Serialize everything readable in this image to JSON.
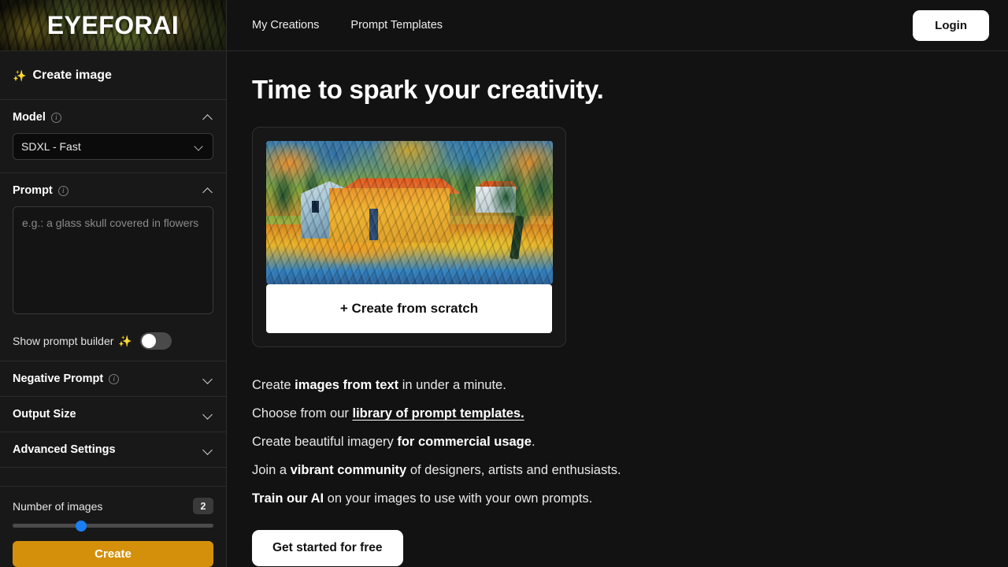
{
  "brand": {
    "logo_text": "EYEFORAI"
  },
  "topnav": {
    "links": [
      {
        "label": "My Creations"
      },
      {
        "label": "Prompt Templates"
      }
    ],
    "login_label": "Login"
  },
  "sidebar": {
    "create_image_label": "Create image",
    "sparkle_icon": "✨",
    "model": {
      "title": "Model",
      "info_icon": "i",
      "selected": "SDXL - Fast"
    },
    "prompt": {
      "title": "Prompt",
      "info_icon": "i",
      "placeholder": "e.g.: a glass skull covered in flowers",
      "value": "",
      "builder_label": "Show prompt builder",
      "builder_sparkle": "✨",
      "builder_enabled": "off"
    },
    "negative_prompt": {
      "title": "Negative Prompt",
      "info_icon": "i"
    },
    "output_size": {
      "title": "Output Size"
    },
    "advanced_settings": {
      "title": "Advanced Settings"
    },
    "number_of_images": {
      "label": "Number of images",
      "value": "2",
      "min": "1",
      "max": "4"
    },
    "create_button": "Create"
  },
  "main": {
    "headline": "Time to spark your creativity.",
    "card": {
      "footer_label": "+ Create from scratch",
      "artwork_alt": "impressionist painting of a house in an orchard"
    },
    "features": [
      {
        "pre": "Create ",
        "bold": "images from text",
        "post": " in under a minute."
      },
      {
        "pre": "Choose from our ",
        "link": "library of prompt templates.",
        "post": ""
      },
      {
        "pre": "Create beautiful imagery ",
        "bold": "for commercial usage",
        "post": "."
      },
      {
        "pre": "Join a ",
        "bold": "vibrant community",
        "post": " of designers, artists and enthusiasts."
      },
      {
        "pre": "",
        "bold": "Train our AI",
        "post": " on your images to use with your own prompts."
      }
    ],
    "cta_label": "Get started for free"
  },
  "colors": {
    "accent_orange": "#d4900a",
    "slider_blue": "#1a7ff0",
    "background": "#121212",
    "sidebar": "#181818"
  }
}
